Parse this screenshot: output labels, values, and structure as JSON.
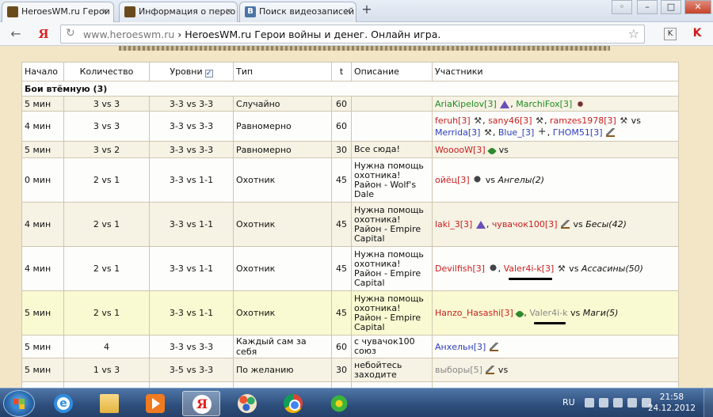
{
  "browser": {
    "tabs": [
      {
        "title": "HeroesWM.ru Герои в",
        "active": true
      },
      {
        "title": "Информация о персо",
        "active": false
      },
      {
        "title": "Поиск видеозаписей",
        "active": false
      }
    ],
    "new_tab": "+",
    "close_glyph": "×",
    "window_buttons": [
      "◦",
      "–",
      "□",
      "✕"
    ],
    "back": "←",
    "yandex_button": "Я",
    "reload": "↻",
    "url_host": "www.heroeswm.ru",
    "page_title_in_omnibox": "HeroesWM.ru Герои войны и денег. Онлайн игра.",
    "star": "☆",
    "ext_label": "K",
    "ext2_label": "K"
  },
  "table": {
    "headers": [
      "Начало",
      "Количество",
      "Уровни",
      "Тип",
      "t",
      "Описание",
      "Участники"
    ],
    "levels_checkbox": "✓",
    "section_title": "Бои втёмную (3)",
    "rows": [
      {
        "start": "5 мин",
        "count": "3 vs 3",
        "levels": "3-3 vs 3-3",
        "type": "Случайно",
        "t": "60",
        "desc": "",
        "players": [
          {
            "text": "AriaKipelov[3]",
            "color": "green",
            "icon": "hat"
          },
          {
            "sep": ", "
          },
          {
            "text": "MarchiFox[3]",
            "color": "green",
            "icon": "cat"
          }
        ]
      },
      {
        "start": "4 мин",
        "count": "3 vs 3",
        "levels": "3-3 vs 3-3",
        "type": "Равномерно",
        "t": "60",
        "desc": "",
        "players": [
          {
            "text": "feruh[3]",
            "color": "red",
            "icon": "claw"
          },
          {
            "sep": ", "
          },
          {
            "text": "sany46[3]",
            "color": "red",
            "icon": "claw"
          },
          {
            "sep": ", "
          },
          {
            "text": "ramzes1978[3]",
            "color": "red",
            "icon": "claw"
          },
          {
            "sep": " vs "
          },
          {
            "br": true
          },
          {
            "text": "Merrida[3]",
            "color": "blue",
            "icon": "claw"
          },
          {
            "sep": ", "
          },
          {
            "text": "Blue_[3]",
            "color": "blue",
            "icon": "cross"
          },
          {
            "sep": ", "
          },
          {
            "text": "ГНОМ51[3]",
            "color": "blue",
            "icon": "sword"
          }
        ]
      },
      {
        "start": "5 мин",
        "count": "3 vs 2",
        "levels": "3-3 vs 3-3",
        "type": "Равномерно",
        "t": "30",
        "desc": "Все сюда!",
        "players": [
          {
            "text": "WooooW[3]",
            "color": "red",
            "icon": "leaf"
          },
          {
            "sep": " vs"
          }
        ]
      },
      {
        "start": "0 мин",
        "count": "2 vs 1",
        "levels": "3-3 vs 1-1",
        "type": "Охотник",
        "t": "45",
        "desc": "Нужна помощь охотника! Район - Wolf's Dale",
        "players": [
          {
            "text": "ойёц[3]",
            "color": "red",
            "icon": "knight"
          },
          {
            "sep": " vs "
          },
          {
            "mob": "Ангелы(2)"
          }
        ]
      },
      {
        "start": "4 мин",
        "count": "2 vs 1",
        "levels": "3-3 vs 1-1",
        "type": "Охотник",
        "t": "45",
        "desc": "Нужна помощь охотника! Район - Empire Capital",
        "players": [
          {
            "text": "laki_3[3]",
            "color": "red",
            "icon": "hat"
          },
          {
            "sep": ", "
          },
          {
            "text": "чувачок100[3]",
            "color": "red",
            "icon": "sword"
          },
          {
            "sep": " vs "
          },
          {
            "mob": "Бесы(42)"
          }
        ]
      },
      {
        "start": "4 мин",
        "count": "2 vs 1",
        "levels": "3-3 vs 1-1",
        "type": "Охотник",
        "t": "45",
        "desc": "Нужна помощь охотника! Район - Empire Capital",
        "players": [
          {
            "text": "Devilfish[3]",
            "color": "red",
            "icon": "knight"
          },
          {
            "sep": ", "
          },
          {
            "text": "Valer4i-k[3]",
            "color": "red",
            "icon": "claw",
            "marked": true
          },
          {
            "sep": " vs "
          },
          {
            "mob": "Ассасины(50)"
          }
        ]
      },
      {
        "start": "5 мин",
        "count": "2 vs 1",
        "levels": "3-3 vs 1-1",
        "type": "Охотник",
        "t": "45",
        "desc": "Нужна помощь охотника! Район - Empire Capital",
        "highlight": true,
        "players": [
          {
            "text": "Hanzo_Hasashi[3]",
            "color": "red",
            "icon": "leaf"
          },
          {
            "sep": ", "
          },
          {
            "text": "Valer4i-k",
            "color": "gray",
            "marked": true
          },
          {
            "sep": " vs "
          },
          {
            "mob": "Маги(5)"
          }
        ]
      },
      {
        "start": "5 мин",
        "count": "4",
        "levels": "3-3 vs 3-3",
        "type": "Каждый сам за себя",
        "t": "60",
        "desc": "с чувачок100 союз",
        "players": [
          {
            "text": "Анхельн[3]",
            "color": "blue",
            "icon": "sword"
          }
        ]
      },
      {
        "start": "5 мин",
        "count": "1 vs 3",
        "levels": "3-5 vs 3-3",
        "type": "По желанию",
        "t": "30",
        "desc": "небойтесь заходите",
        "players": [
          {
            "text": "выборы[5]",
            "color": "gray",
            "icon": "sword"
          },
          {
            "sep": " vs"
          }
        ]
      },
      {
        "start": "",
        "count": "",
        "levels": "",
        "type": "",
        "t": "",
        "desc": "",
        "players": []
      }
    ]
  },
  "taskbar": {
    "apps": [
      {
        "name": "internet-explorer",
        "icon": "ie-icon",
        "label": "e",
        "state": "pinned"
      },
      {
        "name": "explorer",
        "icon": "folder-icon",
        "label": "",
        "state": "pinned"
      },
      {
        "name": "media-player",
        "icon": "media-icon",
        "label": "",
        "state": "pinned"
      },
      {
        "name": "yandex-browser",
        "icon": "yandex-icon",
        "label": "Я",
        "state": "active"
      },
      {
        "name": "paint",
        "icon": "paint-icon",
        "label": "",
        "state": "pinned"
      },
      {
        "name": "chrome",
        "icon": "chrome-icon",
        "label": "",
        "state": "pinned"
      },
      {
        "name": "icq",
        "icon": "icq-icon",
        "label": "",
        "state": "pinned"
      }
    ],
    "lang": "RU",
    "time": "21:58",
    "date": "24.12.2012"
  },
  "colors": {
    "page_bg": "#f2e6c7",
    "player_green": "#1f8c1f",
    "player_red": "#c81e1e",
    "player_blue": "#2d3ebb",
    "player_gray": "#888888",
    "highlight_row": "#fafad2"
  }
}
